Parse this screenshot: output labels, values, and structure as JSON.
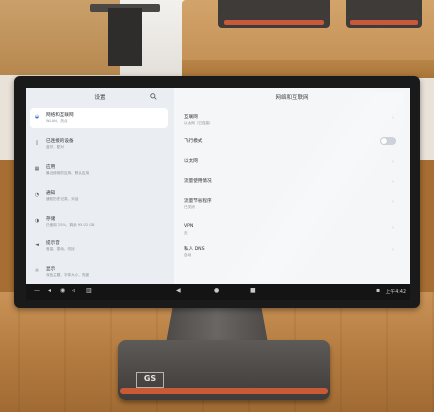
{
  "stand": {
    "logo": "GS"
  },
  "settings": {
    "left_title": "设置",
    "right_title": "网络和互联网",
    "nav": [
      {
        "title": "网络和互联网",
        "sub": "WLAN、热点",
        "icon": "wifi-icon"
      },
      {
        "title": "已连接的设备",
        "sub": "蓝牙、配对",
        "icon": "devices-icon"
      },
      {
        "title": "应用",
        "sub": "最近使用的应用、默认应用",
        "icon": "apps-icon"
      },
      {
        "title": "通知",
        "sub": "通知历史记录、对话",
        "icon": "bell-icon"
      },
      {
        "title": "存储",
        "sub": "已使用 25%，剩余 95.02 GB",
        "icon": "storage-icon"
      },
      {
        "title": "提示音",
        "sub": "音量、振动、勿扰",
        "icon": "sound-icon"
      },
      {
        "title": "显示",
        "sub": "深色主题、字体大小、亮度",
        "icon": "display-icon"
      }
    ],
    "rows": [
      {
        "title": "互联网",
        "sub": "以太网（已连接）"
      },
      {
        "title": "飞行模式",
        "sub": ""
      },
      {
        "title": "以太网",
        "sub": ""
      },
      {
        "title": "流量使用情况",
        "sub": ""
      },
      {
        "title": "流量节省程序",
        "sub": "已关闭"
      },
      {
        "title": "VPN",
        "sub": "无"
      },
      {
        "title": "私人 DNS",
        "sub": "自动"
      }
    ],
    "airplane_mode_on": false
  },
  "system_bar": {
    "time": "上午4:42"
  }
}
